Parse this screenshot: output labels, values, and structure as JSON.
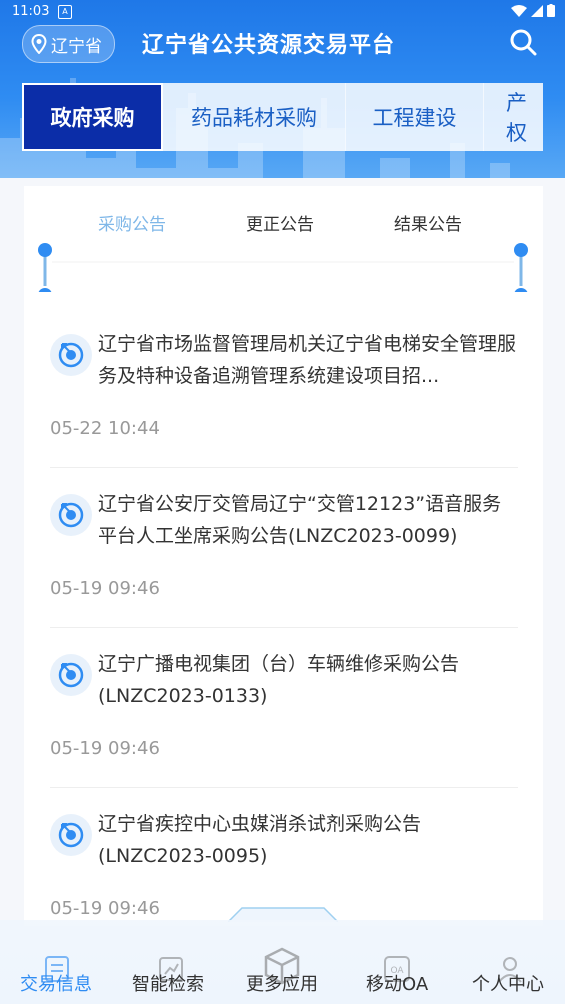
{
  "status_bar": {
    "time": "11:03",
    "notification": "A"
  },
  "header": {
    "location": "辽宁省",
    "title": "辽宁省公共资源交易平台",
    "categories": [
      "政府采购",
      "药品耗材采购",
      "工程建设",
      "产权"
    ]
  },
  "tabs": [
    "采购公告",
    "更正公告",
    "结果公告"
  ],
  "items": [
    {
      "title": "辽宁省市场监督管理局机关辽宁省电梯安全管理服务及特种设备追溯管理系统建设项目招...",
      "date": "05-22 10:44"
    },
    {
      "title": "辽宁省公安厅交管局辽宁“交管12123”语音服务平台人工坐席采购公告(LNZC2023-0099)",
      "date": "05-19 09:46"
    },
    {
      "title": "辽宁广播电视集团（台）车辆维修采购公告(LNZC2023-0133)",
      "date": "05-19 09:46"
    },
    {
      "title": "辽宁省疾控中心虫媒消杀试剂采购公告(LNZC2023-0095)",
      "date": "05-19 09:46"
    }
  ],
  "bottom_nav": [
    "交易信息",
    "智能检索",
    "更多应用",
    "移动OA",
    "个人中心"
  ],
  "colors": {
    "primary": "#2f8cf2",
    "active_category": "#0b2da8",
    "active_tab": "#7fb7e8"
  }
}
